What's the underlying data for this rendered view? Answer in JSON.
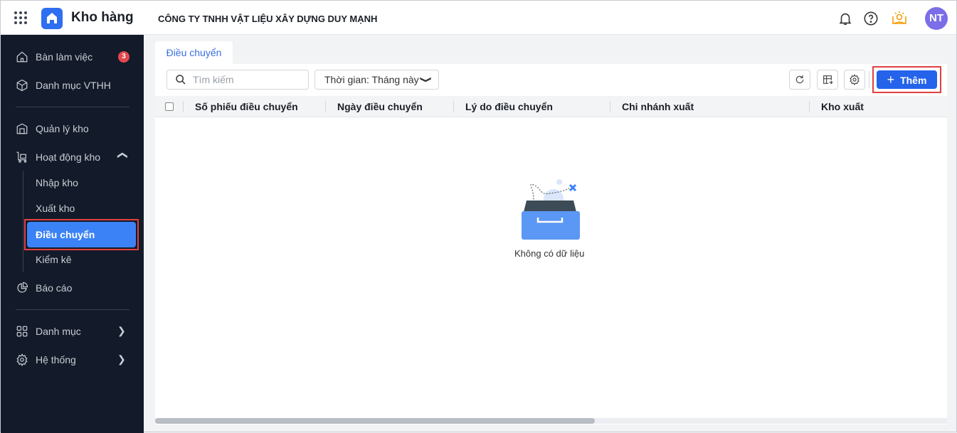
{
  "header": {
    "app_title": "Kho hàng",
    "company": "CÔNG TY TNHH VẬT LIỆU XÂY DỰNG DUY MẠNH",
    "avatar_initials": "NT"
  },
  "sidebar": {
    "items": [
      {
        "label": "Bàn làm việc",
        "badge": "3"
      },
      {
        "label": "Danh mục VTHH"
      },
      {
        "label": "Quản lý kho"
      },
      {
        "label": "Hoạt động kho",
        "children": [
          "Nhập kho",
          "Xuất kho",
          "Điều chuyển",
          "Kiểm kê"
        ]
      },
      {
        "label": "Báo cáo"
      },
      {
        "label": "Danh mục"
      },
      {
        "label": "Hệ thống"
      }
    ]
  },
  "main": {
    "tab": "Điều chuyển",
    "search_placeholder": "Tìm kiếm",
    "time_filter": "Thời gian: Tháng này",
    "add_label": "Thêm",
    "columns": [
      "Số phiếu điều chuyển",
      "Ngày điều chuyển",
      "Lý do điều chuyển",
      "Chi nhánh xuất",
      "Kho xuất"
    ],
    "empty_text": "Không có dữ liệu"
  },
  "colors": {
    "accent": "#2563eb",
    "sidebar_bg": "#131a29",
    "active_item": "#3b82f6",
    "highlight": "#e04040"
  }
}
